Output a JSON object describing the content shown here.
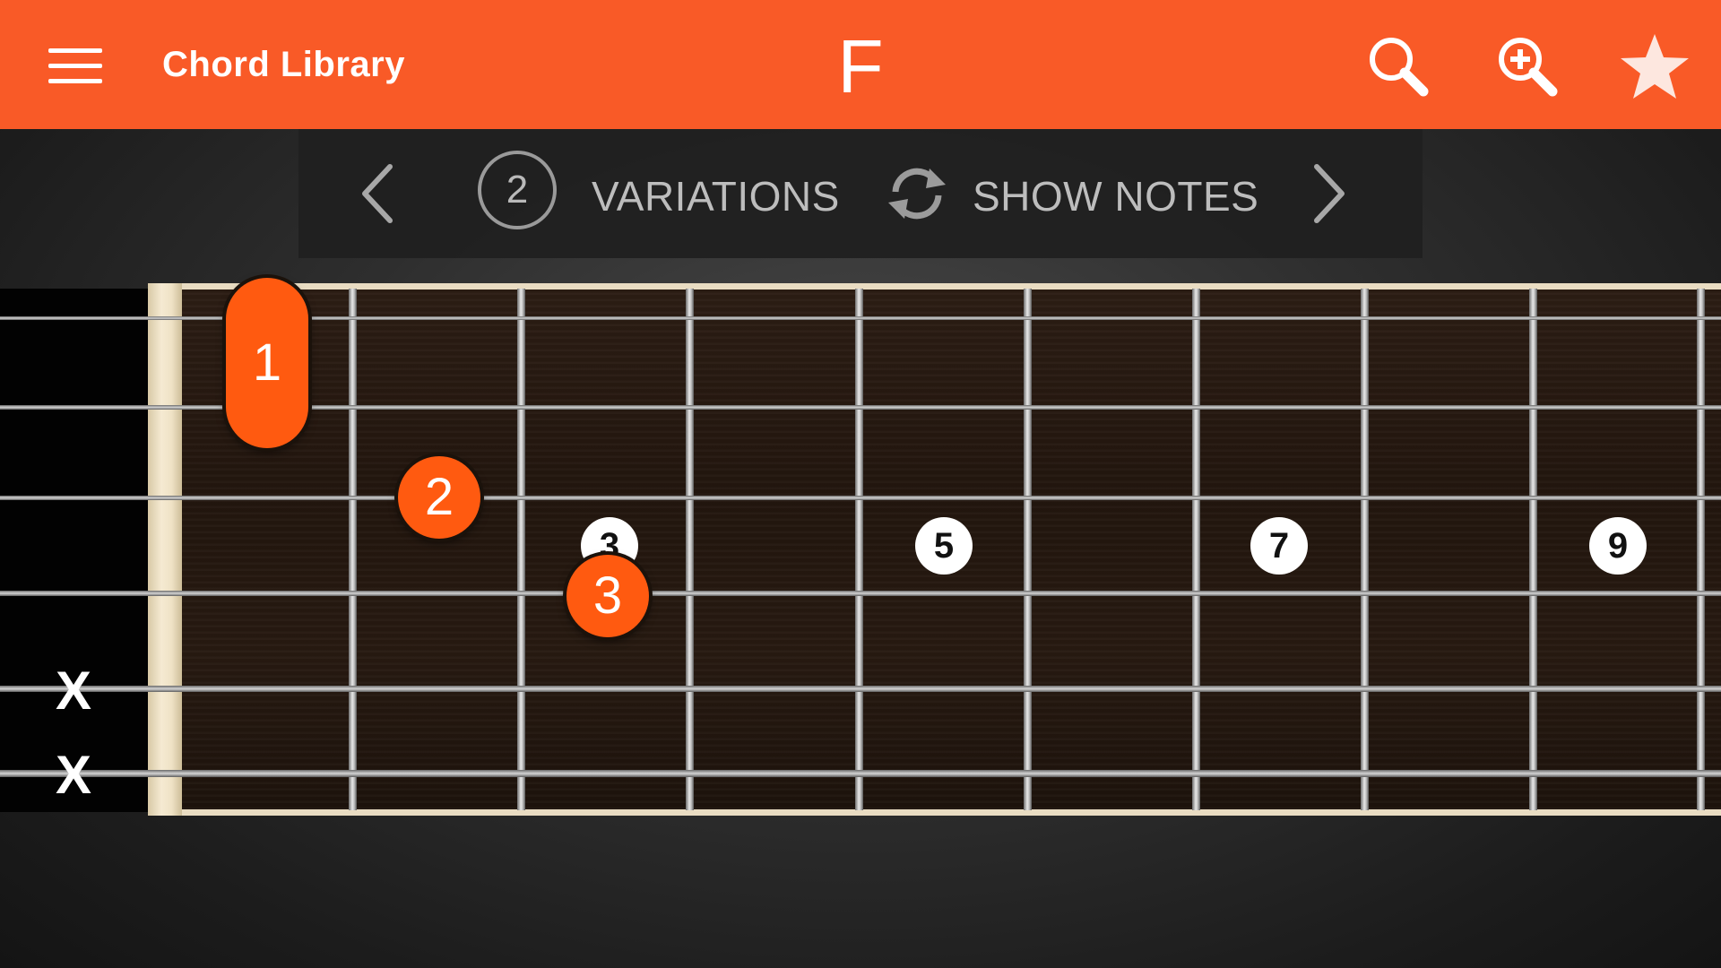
{
  "app_bar": {
    "title": "Chord Library",
    "chord": "F",
    "accent_color": "#f95a27",
    "icons": [
      "menu-icon",
      "search-icon",
      "zoom-in-icon",
      "star-icon"
    ]
  },
  "toolbar": {
    "variation_count": "2",
    "variations_label": "VARIATIONS",
    "show_notes_label": "SHOW NOTES",
    "icons": [
      "chevron-left-icon",
      "refresh-icon",
      "chevron-right-icon"
    ]
  },
  "fretboard": {
    "muted_strings": [
      "X",
      "X"
    ],
    "inlays": [
      "3",
      "5",
      "7",
      "9"
    ],
    "fingers": {
      "barre": "1",
      "second": "2",
      "third": "3"
    },
    "finger_color": "#ff5a10"
  }
}
